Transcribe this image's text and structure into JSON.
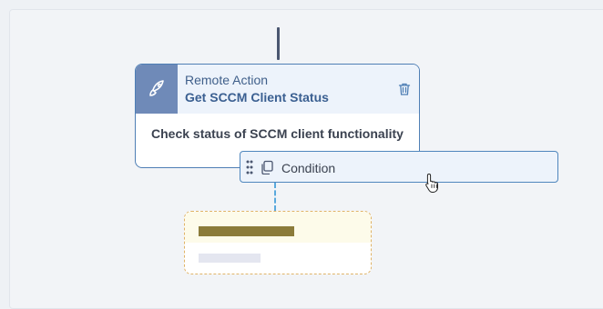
{
  "action_node": {
    "type_label": "Remote Action",
    "name": "Get SCCM Client Status",
    "description": "Check status of SCCM client functionality",
    "icon": "rocket-icon",
    "delete_icon": "trash-icon"
  },
  "condition_node": {
    "label": "Condition",
    "handle_icon": "drag-handle-icon",
    "icon": "copy-icon"
  },
  "placeholder_node": {
    "state": "loading"
  },
  "colors": {
    "accent": "#4f7fb5",
    "icon_bg": "#6f8ab8",
    "header_bg": "#edf3fb",
    "placeholder_border": "#e0b468",
    "dashed_connector": "#5aa9dd"
  }
}
